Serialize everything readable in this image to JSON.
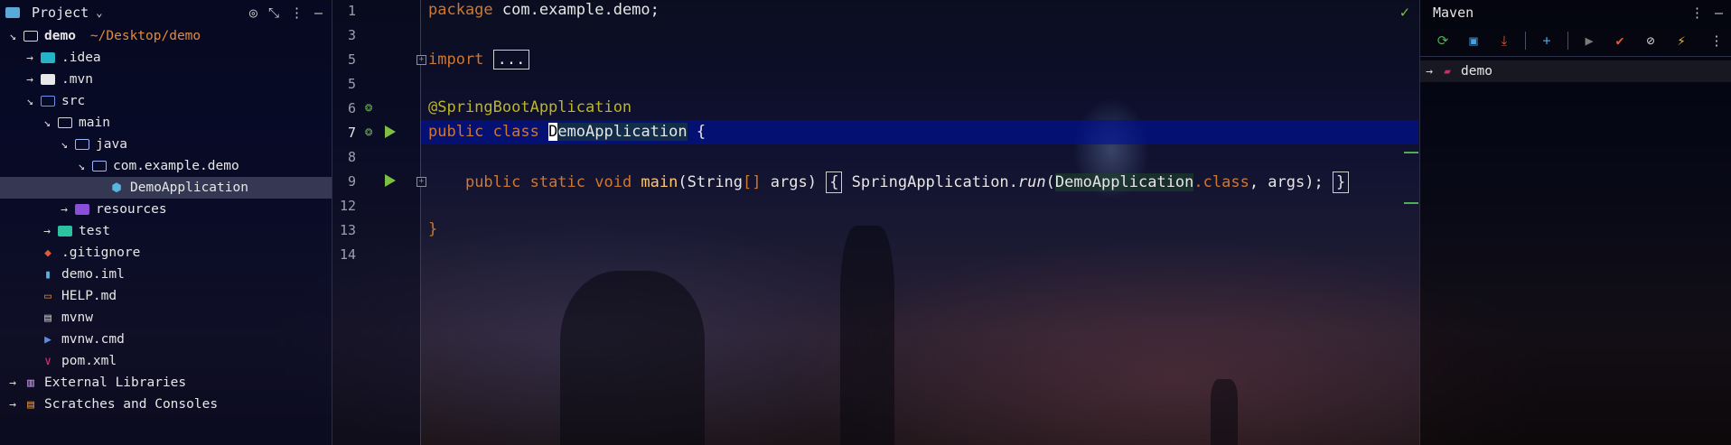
{
  "project_panel": {
    "title": "Project",
    "header_icons": [
      "target-icon",
      "collapse-icon",
      "more-icon",
      "minimize-icon"
    ],
    "tree": [
      {
        "label": "demo",
        "hint": "~/Desktop/demo",
        "arrow": "↘",
        "icon": "folder-outline-icon",
        "indent": 0,
        "bold": true
      },
      {
        "label": ".idea",
        "arrow": "→",
        "icon": "folder-cyan-icon",
        "indent": 1
      },
      {
        "label": ".mvn",
        "arrow": "→",
        "icon": "folder-icon",
        "indent": 1
      },
      {
        "label": "src",
        "arrow": "↘",
        "icon": "folder-source-icon",
        "indent": 1
      },
      {
        "label": "main",
        "arrow": "↘",
        "icon": "folder-outline-icon",
        "indent": 2
      },
      {
        "label": "java",
        "arrow": "↘",
        "icon": "folder-blue-icon",
        "indent": 3
      },
      {
        "label": "com.example.demo",
        "arrow": "↘",
        "icon": "package-icon",
        "indent": 4
      },
      {
        "label": "DemoApplication",
        "arrow": "",
        "icon": "spring-class-icon",
        "indent": 5,
        "selected": true
      },
      {
        "label": "resources",
        "arrow": "→",
        "icon": "folder-resources-icon",
        "indent": 3
      },
      {
        "label": "test",
        "arrow": "→",
        "icon": "folder-test-icon",
        "indent": 2
      },
      {
        "label": ".gitignore",
        "arrow": "",
        "icon": "git-icon",
        "indent": 1
      },
      {
        "label": "demo.iml",
        "arrow": "",
        "icon": "iml-icon",
        "indent": 1
      },
      {
        "label": "HELP.md",
        "arrow": "",
        "icon": "markdown-icon",
        "indent": 1
      },
      {
        "label": "mvnw",
        "arrow": "",
        "icon": "text-file-icon",
        "indent": 1
      },
      {
        "label": "mvnw.cmd",
        "arrow": "",
        "icon": "shell-script-icon",
        "indent": 1
      },
      {
        "label": "pom.xml",
        "arrow": "",
        "icon": "maven-file-icon",
        "indent": 1
      },
      {
        "label": "External Libraries",
        "arrow": "→",
        "icon": "library-icon",
        "indent": 0
      },
      {
        "label": "Scratches and Consoles",
        "arrow": "→",
        "icon": "scratches-icon",
        "indent": 0
      }
    ]
  },
  "editor": {
    "line_numbers": [
      "1",
      "3",
      "5",
      "6",
      "7",
      "8",
      "9",
      "12",
      "13",
      "14"
    ],
    "code": {
      "l1_kw": "package",
      "l1_rest": " com.example.demo;",
      "l3_kw": "import",
      "l3_fold": "...",
      "l6_ann": "@SpringBootApplication",
      "l7_kw": "public class",
      "l7_caret": "D",
      "l7_name": "emoApplication",
      "l7_brace": " {",
      "l9_kw": "public static void",
      "l9_method": " main",
      "l9_params_open": "(String",
      "l9_arr": "[]",
      "l9_args": " args)",
      "l9_brace_open": "{",
      "l9_class": " SpringApplication.",
      "l9_run": "run",
      "l9_paren": "(",
      "l9_demo": "DemoApplication",
      "l9_dotclass": ".class",
      "l9_end": ", args);",
      "l9_brace_close": "}",
      "l13_brace": "}"
    },
    "status_icon": "check-icon"
  },
  "maven_panel": {
    "title": "Maven",
    "toolbar": [
      "reload-icon",
      "add-folder-icon",
      "download-icon",
      "plus-icon",
      "run-icon",
      "maven-goal-icon",
      "skip-tests-icon",
      "lightning-icon",
      "more-icon"
    ],
    "tree": [
      {
        "label": "demo",
        "arrow": "→",
        "icon": "maven-module-icon"
      }
    ]
  },
  "colors": {
    "keyword": "#cc7832",
    "annotation": "#bbb529",
    "selection_line": "#0012a0",
    "run_green": "#7bc043",
    "path_hint": "#e08b3a"
  }
}
